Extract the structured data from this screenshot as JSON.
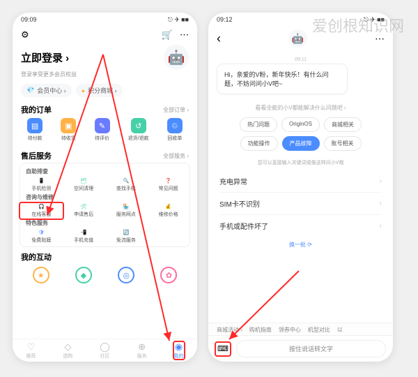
{
  "watermark": "爱创根知识网",
  "phone1": {
    "status": {
      "time": "09:09",
      "icons": "▯ ▯ ⚡",
      "right": "⎋ ✈ ■■"
    },
    "top": {
      "settings": "⚙",
      "cart": "🛒",
      "msg": "⋯"
    },
    "avatar": "🤖",
    "login": {
      "title": "立即登录 ›",
      "sub": "登录享受更多会员权益"
    },
    "chips": [
      {
        "icon": "💎",
        "label": "会员中心 ›",
        "color": "#5da2ff"
      },
      {
        "icon": "●",
        "label": "积分商城 ›",
        "color": "#ffb347"
      }
    ],
    "orders": {
      "title": "我的订单",
      "link": "全部订单 ›",
      "items": [
        {
          "icon": "",
          "label": "待付款"
        },
        {
          "icon": "",
          "label": "待收货"
        },
        {
          "icon": "",
          "label": "待评价"
        },
        {
          "icon": "",
          "label": "退货/退款"
        },
        {
          "icon": "",
          "label": "回收单"
        }
      ]
    },
    "after": {
      "title": "售后服务",
      "link": "全部服务 ›",
      "s1": {
        "label": "自助排查",
        "items": [
          {
            "icon": "📱",
            "label": "手机检测",
            "color": "#4b8cff"
          },
          {
            "icon": "🗂",
            "label": "空间清理",
            "color": "#46d0a8"
          },
          {
            "icon": "🔍",
            "label": "查找手机",
            "color": "#ff8a47"
          },
          {
            "icon": "❓",
            "label": "常见问题",
            "color": "#ffb347"
          }
        ]
      },
      "s2": {
        "label": "咨询与维修",
        "items": [
          {
            "icon": "🎧",
            "label": "在线客服",
            "color": "#4b8cff"
          },
          {
            "icon": "🛠",
            "label": "申请售后",
            "color": "#46d0a8"
          },
          {
            "icon": "🏪",
            "label": "服务网点",
            "color": "#ff8a47"
          },
          {
            "icon": "💰",
            "label": "维修价格",
            "color": "#ffb347"
          }
        ]
      },
      "s3": {
        "label": "特色服务",
        "items": [
          {
            "icon": "🛡",
            "label": "免费贴膜",
            "color": "#4b8cff"
          },
          {
            "icon": "📲",
            "label": "手机充值",
            "color": "#46d0a8"
          },
          {
            "icon": "🔄",
            "label": "免流服务",
            "color": "#ff8a47"
          }
        ]
      }
    },
    "interact": {
      "title": "我的互动",
      "items": [
        {
          "color": "#ffb347"
        },
        {
          "color": "#46d0a8"
        },
        {
          "color": "#4b8cff"
        },
        {
          "color": "#ff6b9d"
        }
      ]
    },
    "tabs": [
      {
        "icon": "♡",
        "label": "推荐"
      },
      {
        "icon": "◇",
        "label": "选购"
      },
      {
        "icon": "◯",
        "label": "社区"
      },
      {
        "icon": "⊕",
        "label": "服务"
      },
      {
        "icon": "◉",
        "label": "我的"
      }
    ]
  },
  "phone2": {
    "status": {
      "time": "09:12",
      "icons": "● ● ● ⬢",
      "right": "⎋ ✈ ■■"
    },
    "back": "‹",
    "more": "⋯",
    "avatar": "🤖",
    "msg_time": "09:11",
    "bubble": "Hi，亲爱的V粉，新年快乐！有什么问题，不妨问问小V吧~",
    "prompt": "看看全能的小V都能解决什么问题吧 ›",
    "pills": [
      "热门问题",
      "OriginOS",
      "商城相关",
      "功能操作",
      "产品故障",
      "账号相关"
    ],
    "active_pill": 4,
    "hint": "您可以直接输入关键词或像这样问小V哦",
    "questions": [
      "充电异常",
      "SIM卡不识别",
      "手机或配件坏了"
    ],
    "refresh": "换一批 ⟳",
    "suggestions": [
      "商城活动 ›",
      "购机指南",
      "领券中心",
      "机型对比",
      "以"
    ],
    "input": {
      "kbd": "⌨",
      "placeholder": "按住说话转文字"
    }
  }
}
